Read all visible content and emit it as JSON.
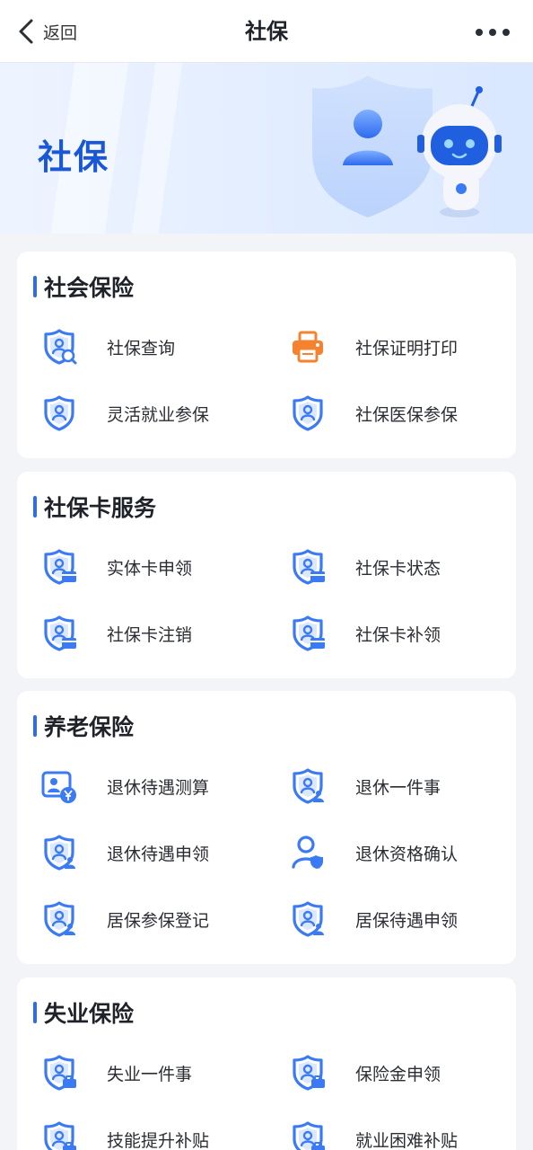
{
  "nav": {
    "back_label": "返回",
    "title": "社保"
  },
  "banner": {
    "title": "社保"
  },
  "colors": {
    "accent": "#2f6bf0",
    "icon_blue": "#3a7bf5",
    "icon_orange": "#f5822f"
  },
  "sections": [
    {
      "title": "社会保险",
      "items": [
        {
          "label": "社保查询",
          "icon": "shield-search-icon"
        },
        {
          "label": "社保证明打印",
          "icon": "printer-icon"
        },
        {
          "label": "灵活就业参保",
          "icon": "shield-user-icon"
        },
        {
          "label": "社保医保参保",
          "icon": "shield-user-icon"
        }
      ]
    },
    {
      "title": "社保卡服务",
      "items": [
        {
          "label": "实体卡申领",
          "icon": "shield-card-icon"
        },
        {
          "label": "社保卡状态",
          "icon": "shield-card-icon"
        },
        {
          "label": "社保卡注销",
          "icon": "shield-card-icon"
        },
        {
          "label": "社保卡补领",
          "icon": "shield-card-icon"
        }
      ]
    },
    {
      "title": "养老保险",
      "items": [
        {
          "label": "退休待遇测算",
          "icon": "pension-calc-icon"
        },
        {
          "label": "退休一件事",
          "icon": "shield-person-icon"
        },
        {
          "label": "退休待遇申领",
          "icon": "shield-person-icon"
        },
        {
          "label": "退休资格确认",
          "icon": "person-check-icon"
        },
        {
          "label": "居保参保登记",
          "icon": "shield-person-icon"
        },
        {
          "label": "居保待遇申领",
          "icon": "shield-person-icon"
        }
      ]
    },
    {
      "title": "失业保险",
      "items": [
        {
          "label": "失业一件事",
          "icon": "shield-briefcase-icon"
        },
        {
          "label": "保险金申领",
          "icon": "shield-briefcase-icon"
        },
        {
          "label": "技能提升补贴",
          "icon": "shield-briefcase-icon"
        },
        {
          "label": "就业困难补贴",
          "icon": "shield-briefcase-icon"
        }
      ]
    }
  ]
}
